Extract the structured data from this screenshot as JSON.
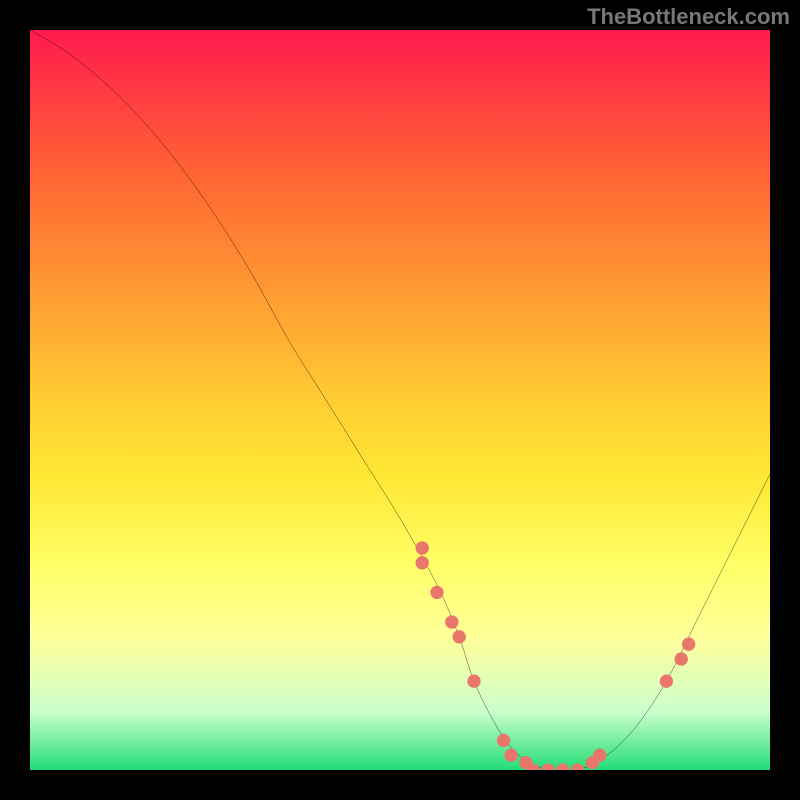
{
  "watermark": "TheBottleneck.com",
  "chart_data": {
    "type": "line",
    "title": "",
    "xlabel": "",
    "ylabel": "",
    "xlim": [
      0,
      100
    ],
    "ylim": [
      0,
      100
    ],
    "curve": {
      "x": [
        0,
        5,
        10,
        15,
        20,
        25,
        30,
        35,
        40,
        45,
        50,
        55,
        58,
        60,
        63,
        66,
        70,
        74,
        78,
        82,
        86,
        90,
        94,
        98,
        100
      ],
      "y": [
        100,
        97,
        93,
        88,
        82,
        75,
        67,
        58,
        50,
        42,
        34,
        25,
        18,
        12,
        6,
        2,
        0,
        0,
        2,
        6,
        12,
        20,
        28,
        36,
        40
      ]
    },
    "marker_points": {
      "x": [
        53,
        53,
        55,
        57,
        58,
        60,
        64,
        65,
        67,
        68,
        70,
        72,
        74,
        76,
        77,
        86,
        88,
        89
      ],
      "y": [
        28,
        30,
        24,
        20,
        18,
        12,
        4,
        2,
        1,
        0,
        0,
        0,
        0,
        1,
        2,
        12,
        15,
        17
      ]
    },
    "gradient_colors": {
      "top": "#ff1a4d",
      "mid": "#ffff66",
      "bottom": "#22dd77"
    }
  }
}
